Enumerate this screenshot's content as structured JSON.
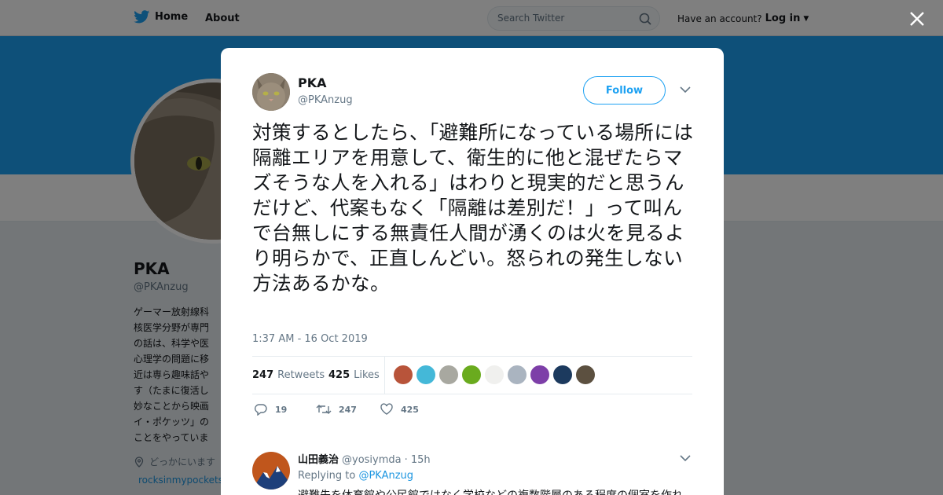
{
  "nav": {
    "home_label": "Home",
    "about_label": "About",
    "search_placeholder": "Search Twitter",
    "account_prompt": "Have an account?",
    "login_label": "Log in"
  },
  "profile": {
    "name": "PKA",
    "handle": "@PKAnzug",
    "bio_lines": [
      "ゲーマー放射線科",
      "核医学分野が専門",
      "の話は、科学や医",
      "心理学の問題に移",
      "近は専ら趣味話や",
      "す（たまに復活し",
      "妙なことから映画",
      "イ・ポケッツ」の",
      "ことをやっていま"
    ],
    "location": "どっかにいます",
    "link": "rocksinmypockets"
  },
  "tweet": {
    "name": "PKA",
    "handle": "@PKAnzug",
    "follow_label": "Follow",
    "text": "対策するとしたら、「避難所になっている場所には隔離エリアを用意して、衛生的に他と混ぜたらマズそうな人を入れる」はわりと現実的だと思うんだけど、代案もなく「隔離は差別だ！」って叫んで台無しにする無責任人間が湧くのは火を見るより明らかで、正直しんどい。怒られの発生しない方法あるかな。",
    "timestamp": "1:37 AM - 16 Oct 2019",
    "retweets_count": "247",
    "retweets_label": "Retweets",
    "likes_count": "425",
    "likes_label": "Likes",
    "reply_count": "19",
    "retweet_action_count": "247",
    "like_action_count": "425"
  },
  "likers": [
    {
      "name": "liker-1",
      "color": "#b8543a"
    },
    {
      "name": "liker-2",
      "color": "#44b8d8"
    },
    {
      "name": "liker-3",
      "color": "#a8a8a0"
    },
    {
      "name": "liker-4",
      "color": "#6aab1e"
    },
    {
      "name": "liker-5",
      "color": "#f0f0ee"
    },
    {
      "name": "liker-6",
      "color": "#aab4c0"
    },
    {
      "name": "liker-7",
      "color": "#7d3fa8"
    },
    {
      "name": "liker-8",
      "color": "#1c3a5e"
    },
    {
      "name": "liker-9",
      "color": "#5c5040"
    }
  ],
  "reply": {
    "name": "山田義治",
    "handle": "@yosiymda",
    "age": "· 15h",
    "replying_prefix": "Replying to",
    "replying_to": "@PKAnzug",
    "text": "避難先を体育館や公民館ではなく学校などの複数階層のある程度の個室を作れ"
  },
  "colors": {
    "brand": "#1da1f2",
    "banner": "#1da1f2",
    "link": "#1b95e0"
  }
}
